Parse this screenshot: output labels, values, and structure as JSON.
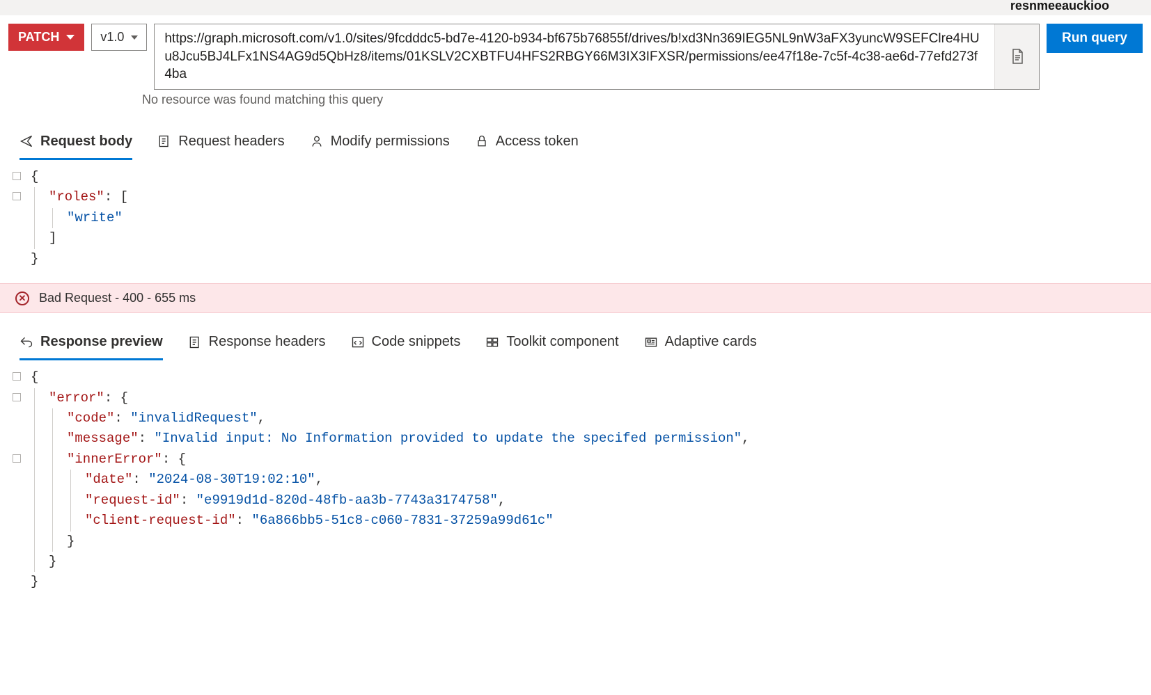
{
  "header": {
    "username": "resnmeeauckioo"
  },
  "query": {
    "method": "PATCH",
    "version": "v1.0",
    "url": "https://graph.microsoft.com/v1.0/sites/9fcdddc5-bd7e-4120-b934-bf675b76855f/drives/b!xd3Nn369IEG5NL9nW3aFX3yuncW9SEFClre4HUu8Jcu5BJ4LFx1NS4AG9d5QbHz8/items/01KSLV2CXBTFU4HFS2RBGY66M3IX3IFXSR/permissions/ee47f18e-7c5f-4c38-ae6d-77efd273f4ba",
    "noResourceMsg": "No resource was found matching this query",
    "runLabel": "Run query"
  },
  "reqTabs": {
    "body": "Request body",
    "headers": "Request headers",
    "permissions": "Modify permissions",
    "token": "Access token"
  },
  "requestBody": {
    "key_roles": "\"roles\"",
    "val_write": "\"write\""
  },
  "status": {
    "text": "Bad Request - 400 - 655 ms"
  },
  "respTabs": {
    "preview": "Response preview",
    "headers": "Response headers",
    "snippets": "Code snippets",
    "toolkit": "Toolkit component",
    "adaptive": "Adaptive cards"
  },
  "response": {
    "key_error": "\"error\"",
    "key_code": "\"code\"",
    "val_code": "\"invalidRequest\"",
    "key_message": "\"message\"",
    "val_message": "\"Invalid input: No Information provided to update the specifed permission\"",
    "key_inner": "\"innerError\"",
    "key_date": "\"date\"",
    "val_date": "\"2024-08-30T19:02:10\"",
    "key_reqid": "\"request-id\"",
    "val_reqid": "\"e9919d1d-820d-48fb-aa3b-7743a3174758\"",
    "key_clientid": "\"client-request-id\"",
    "val_clientid": "\"6a866bb5-51c8-c060-7831-37259a99d61c\""
  }
}
